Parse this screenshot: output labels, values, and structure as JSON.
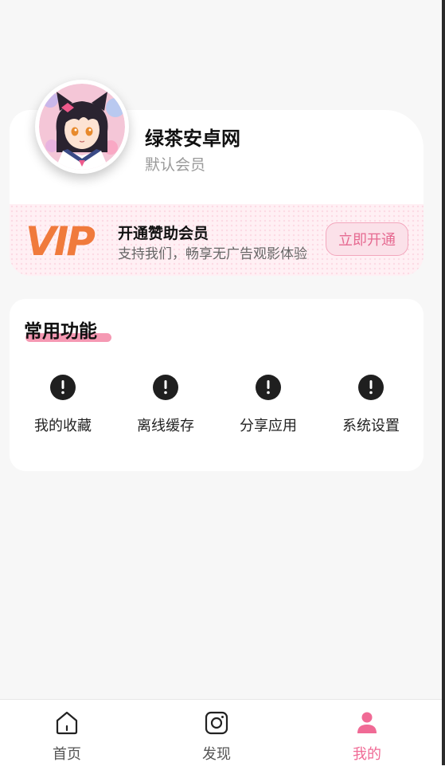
{
  "profile": {
    "username": "绿茶安卓网",
    "member_level": "默认会员"
  },
  "vip": {
    "logo_text": "VIP",
    "title": "开通赞助会员",
    "description": "支持我们，畅享无广告观影体验",
    "button_label": "立即开通"
  },
  "functions": {
    "title": "常用功能",
    "items": [
      {
        "label": "我的收藏",
        "icon": "alert-circle-icon"
      },
      {
        "label": "离线缓存",
        "icon": "alert-circle-icon"
      },
      {
        "label": "分享应用",
        "icon": "alert-circle-icon"
      },
      {
        "label": "系统设置",
        "icon": "alert-circle-icon"
      }
    ]
  },
  "nav": {
    "items": [
      {
        "label": "首页",
        "icon": "home-icon"
      },
      {
        "label": "发现",
        "icon": "camera-icon"
      },
      {
        "label": "我的",
        "icon": "user-icon",
        "active": true
      }
    ]
  },
  "colors": {
    "accent": "#f06a95",
    "vip_orange": "#f07a3c",
    "background": "#f7f7f7"
  }
}
